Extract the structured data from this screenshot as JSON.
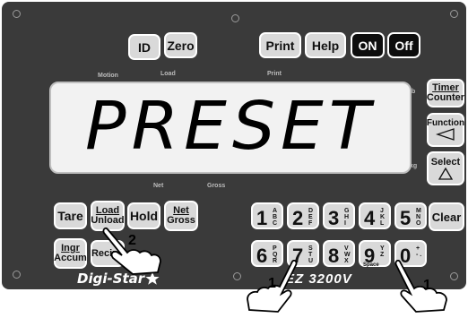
{
  "top_keys": {
    "id": "ID",
    "zero": "Zero",
    "print": "Print",
    "help": "Help",
    "on": "ON",
    "off": "Off"
  },
  "panel_labels": {
    "motion": "Motion",
    "load": "Load",
    "print": "Print",
    "net": "Net",
    "gross": "Gross",
    "lb": "lb",
    "kg": "kg"
  },
  "display": {
    "text": "PRESET"
  },
  "right_keys": {
    "timer_top": "Timer",
    "timer_bottom": "Counter",
    "function": "Function",
    "select": "Select"
  },
  "left_keys": {
    "tare": "Tare",
    "load_top": "Load",
    "load_bottom": "Unload",
    "hold": "Hold",
    "net_top": "Net",
    "net_bottom": "Gross",
    "ingr_top": "Ingr",
    "ingr_bottom": "Accum",
    "recipe": "Recipe"
  },
  "numpad": [
    {
      "digit": "1",
      "letters": "A B C"
    },
    {
      "digit": "2",
      "letters": "D E F"
    },
    {
      "digit": "3",
      "letters": "G H I"
    },
    {
      "digit": "4",
      "letters": "J K L"
    },
    {
      "digit": "5",
      "letters": "M N O"
    },
    {
      "digit": "6",
      "letters": "P Q R"
    },
    {
      "digit": "7",
      "letters": "S T U"
    },
    {
      "digit": "8",
      "letters": "V W X"
    },
    {
      "digit": "9",
      "letters": "Y Z"
    },
    {
      "digit": "0",
      "letters": "+ - ."
    }
  ],
  "numpad_extra": {
    "space": "Space",
    "clear": "Clear"
  },
  "brand": {
    "name": "Digi-Star",
    "model": "EZ 3200V"
  },
  "callouts": {
    "a": "1",
    "b": "2",
    "c": "1"
  },
  "icons": {
    "function": "left-triangle-icon",
    "select": "up-triangle-icon",
    "brand": "star-icon",
    "pointer": "hand-pointer-icon"
  }
}
